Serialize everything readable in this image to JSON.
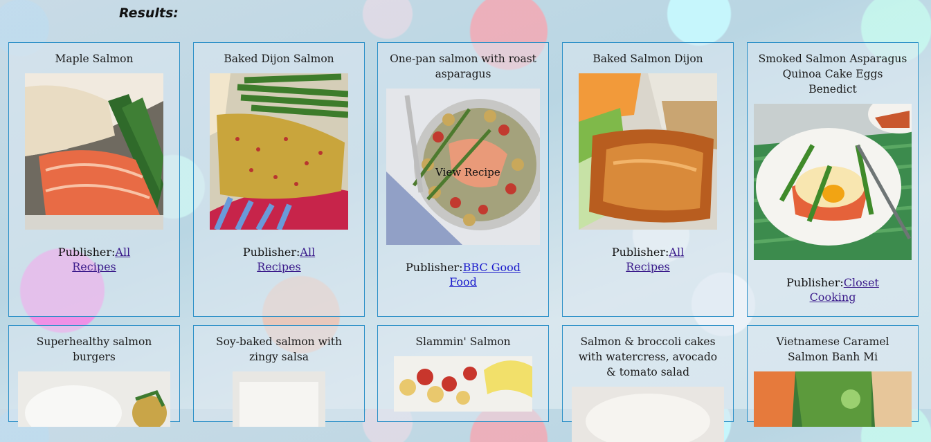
{
  "page": {
    "results_heading": "Results:"
  },
  "recipes": [
    {
      "title": "Maple Salmon",
      "publisher_label": "Publisher:",
      "publisher_name": "All Recipes"
    },
    {
      "title": "Baked Dijon Salmon",
      "publisher_label": "Publisher:",
      "publisher_name": "All Recipes"
    },
    {
      "title": "One-pan salmon with roast asparagus",
      "publisher_label": "Publisher:",
      "publisher_name": "BBC Good Food",
      "overlay": "View Recipe"
    },
    {
      "title": "Baked Salmon Dijon",
      "publisher_label": "Publisher:",
      "publisher_name": "All Recipes"
    },
    {
      "title": "Smoked Salmon Asparagus Quinoa Cake Eggs Benedict",
      "publisher_label": "Publisher:",
      "publisher_name": "Closet Cooking"
    },
    {
      "title": "Superhealthy salmon burgers"
    },
    {
      "title": "Soy-baked salmon with zingy salsa"
    },
    {
      "title": "Slammin' Salmon"
    },
    {
      "title": "Salmon & broccoli cakes with watercress, avocado & tomato salad"
    },
    {
      "title": "Vietnamese Caramel Salmon Banh Mi"
    }
  ],
  "colors": {
    "card_border": "#2a8fc7",
    "link": "#3a1a8a"
  }
}
